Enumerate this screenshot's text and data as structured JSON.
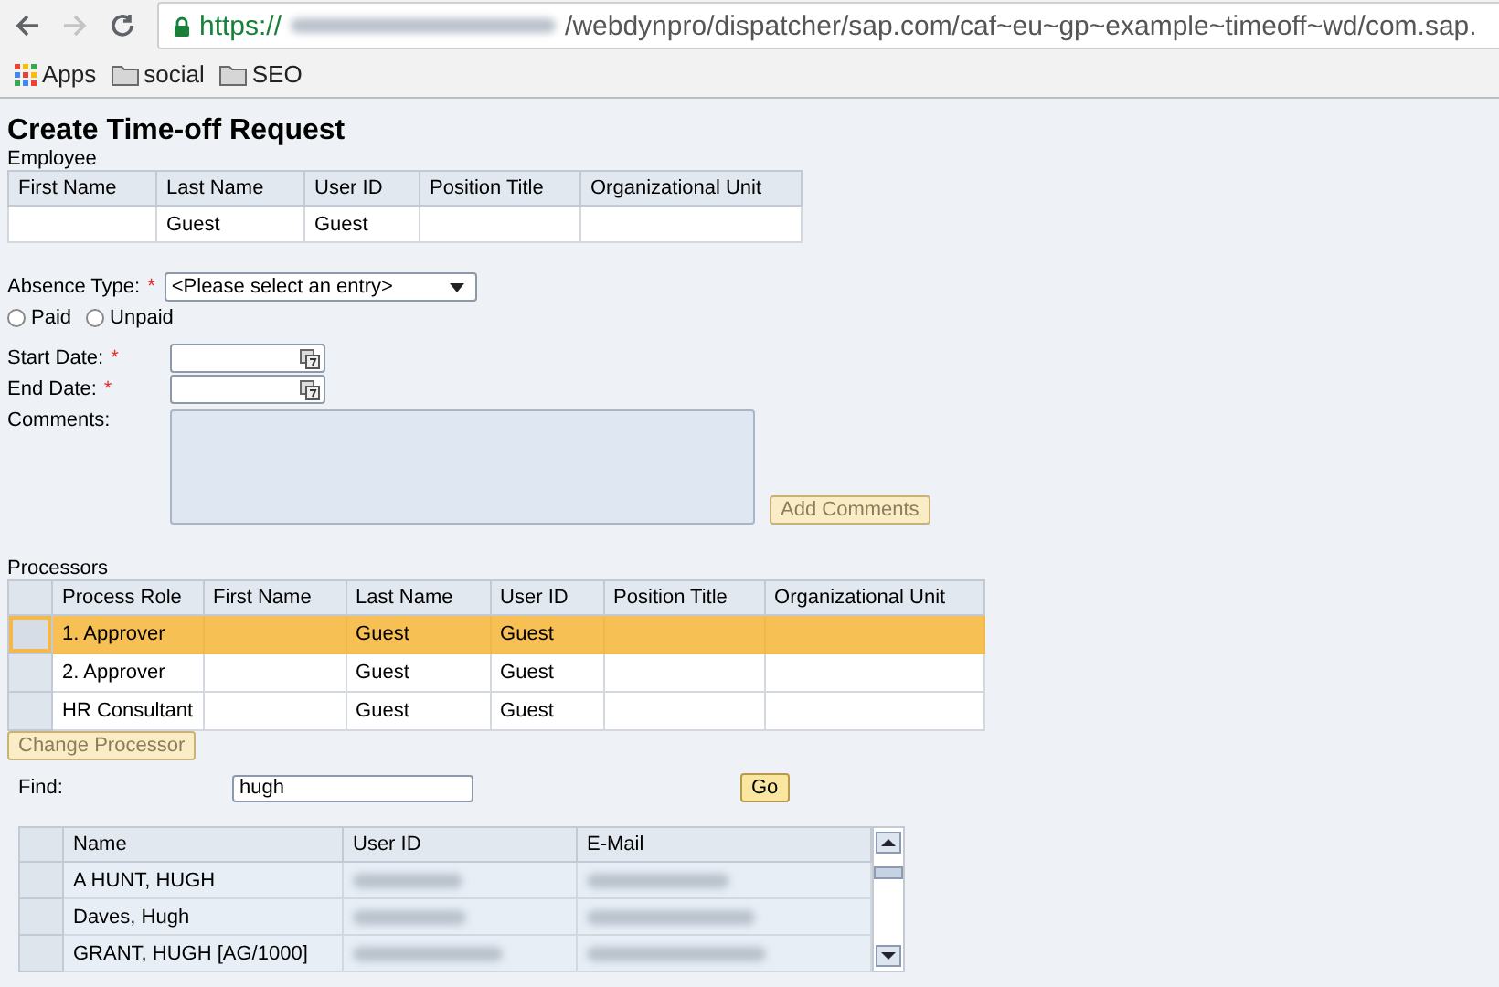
{
  "browser": {
    "url_scheme": "https://",
    "url_path": "/webdynpro/dispatcher/sap.com/caf~eu~gp~example~timeoff~wd/com.sap.",
    "bookmarks": [
      {
        "label": "Apps",
        "kind": "apps"
      },
      {
        "label": "social",
        "kind": "folder"
      },
      {
        "label": "SEO",
        "kind": "folder"
      }
    ]
  },
  "page_title": "Create Time-off Request",
  "employee": {
    "label": "Employee",
    "columns": [
      "First Name",
      "Last Name",
      "User ID",
      "Position Title",
      "Organizational Unit"
    ],
    "rows": [
      [
        null,
        "Guest",
        "Guest",
        null,
        null
      ]
    ]
  },
  "absence_type": {
    "label": "Absence Type:",
    "required_mark": "*",
    "value": "<Please select an entry>"
  },
  "pay_options": [
    {
      "label": "Paid",
      "selected": false
    },
    {
      "label": "Unpaid",
      "selected": false
    }
  ],
  "start_date": {
    "label": "Start Date:",
    "required_mark": "*"
  },
  "end_date": {
    "label": "End Date:",
    "required_mark": "*"
  },
  "comments": {
    "label": "Comments:"
  },
  "add_comments_button": {
    "label": "Add Comments",
    "disabled": true
  },
  "processors": {
    "label": "Processors",
    "columns": [
      "Process Role",
      "First Name",
      "Last Name",
      "User ID",
      "Position Title",
      "Organizational Unit"
    ],
    "rows": [
      {
        "cells": [
          "1. Approver",
          null,
          "Guest",
          "Guest",
          null,
          null
        ],
        "selected": true
      },
      {
        "cells": [
          "2. Approver",
          null,
          "Guest",
          "Guest",
          null,
          null
        ],
        "selected": false
      },
      {
        "cells": [
          "HR Consultant",
          null,
          "Guest",
          "Guest",
          null,
          null
        ],
        "selected": false
      }
    ]
  },
  "change_processor_button": {
    "label": "Change Processor",
    "disabled": true
  },
  "find": {
    "label": "Find:",
    "value": "hugh"
  },
  "go_button": {
    "label": "Go",
    "disabled": false
  },
  "results": {
    "columns": [
      "Name",
      "User ID",
      "E-Mail"
    ],
    "rows": [
      {
        "name": "A HUNT, HUGH",
        "selected": false
      },
      {
        "name": "Daves, Hugh",
        "selected": false
      },
      {
        "name": "GRANT, HUGH [AG/1000]",
        "selected": false
      }
    ]
  }
}
